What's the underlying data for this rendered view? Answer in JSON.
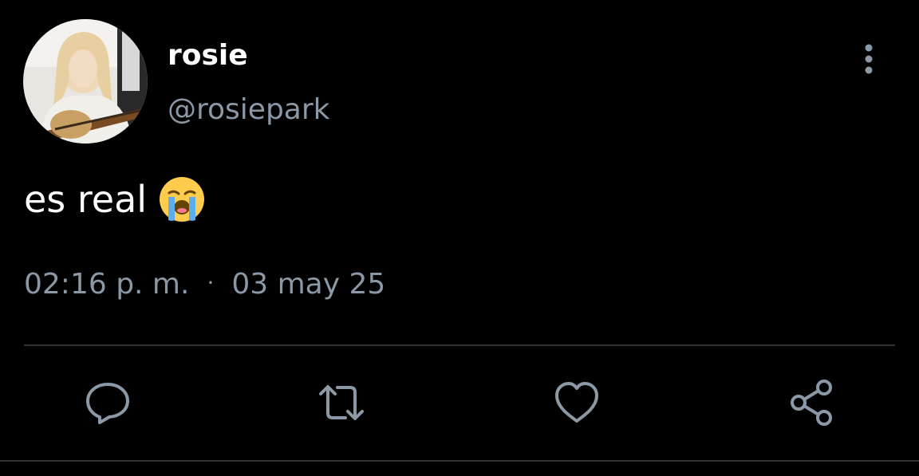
{
  "tweet": {
    "author": {
      "display_name": "rosie",
      "handle": "@rosiepark",
      "avatar": "profile-photo"
    },
    "text": "es real",
    "emoji": "loudly-crying-face",
    "time": "02:16 p. m.",
    "separator": "·",
    "date": "03 may 25"
  },
  "actions": {
    "icons": [
      "reply-icon",
      "retweet-icon",
      "like-icon",
      "share-icon"
    ]
  },
  "colors": {
    "background": "#000000",
    "primary_text": "#ffffff",
    "secondary_text": "#8b98a5",
    "divider": "#2f3336"
  }
}
